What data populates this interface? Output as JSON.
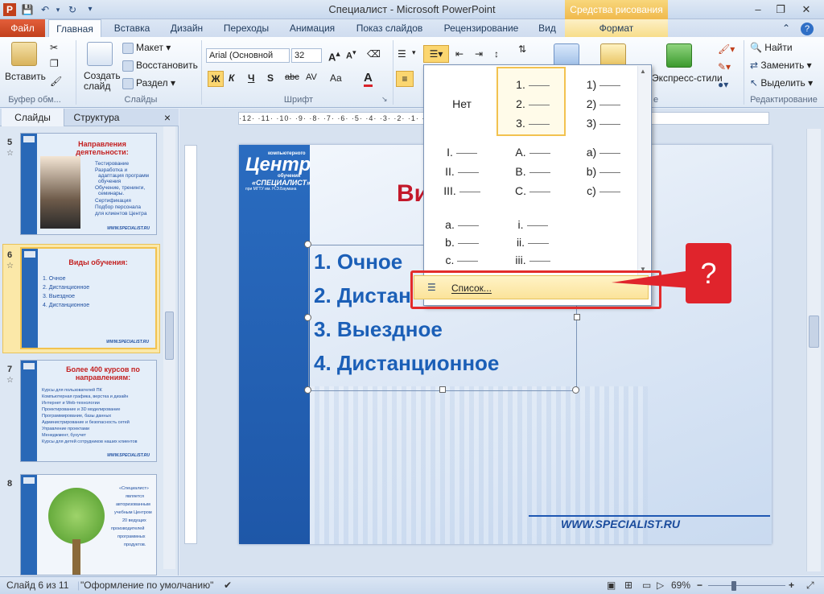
{
  "app": {
    "title": "Специалист - Microsoft PowerPoint",
    "contextual_tab": "Средства рисования"
  },
  "tabs": [
    {
      "label": "Файл"
    },
    {
      "label": "Главная"
    },
    {
      "label": "Вставка"
    },
    {
      "label": "Дизайн"
    },
    {
      "label": "Переходы"
    },
    {
      "label": "Анимация"
    },
    {
      "label": "Показ слайдов"
    },
    {
      "label": "Рецензирование"
    },
    {
      "label": "Вид"
    },
    {
      "label": "Формат"
    }
  ],
  "ribbon": {
    "clipboard": {
      "paste": "Вставить",
      "group": "Буфер обм..."
    },
    "slides": {
      "new_slide": "Создать слайд",
      "layout": "Макет",
      "reset": "Восстановить",
      "section": "Раздел",
      "group": "Слайды"
    },
    "font": {
      "name": "Arial (Основной",
      "size": "32",
      "group": "Шрифт",
      "bold": "Ж",
      "italic": "К",
      "underline": "Ч",
      "shadow": "S",
      "strike": "abc",
      "spacing": "AV",
      "case": "Aa",
      "color": "A"
    },
    "drawing": {
      "quick_styles": "Экспресс-стили",
      "group_suffix": "е"
    },
    "editing": {
      "find": "Найти",
      "replace": "Заменить",
      "select": "Выделить",
      "group": "Редактирование"
    }
  },
  "left_panel": {
    "tabs": [
      "Слайды",
      "Структура"
    ],
    "close": "×",
    "thumbnails": [
      {
        "num": "5",
        "title": "Направления  деятельности:",
        "lines": [
          "Тестирование",
          "Разработка и",
          "адаптация программ",
          "обучения",
          "Обучение, тренинги,",
          "семинары.",
          "Сертификация",
          "Подбор персонала",
          "для клиентов Центра"
        ],
        "footer": "WWW.SPECIALIST.RU"
      },
      {
        "num": "6",
        "title": "Виды обучения:",
        "lines": [
          "1.  Очное",
          "2.  Дистанционное",
          "3.  Выездное",
          "4.  Дистанционное"
        ],
        "footer": "WWW.SPECIALIST.RU"
      },
      {
        "num": "7",
        "title": "Более  400 курсов  по направлениям:",
        "lines": [
          "Курсы для пользователей ПК",
          "Компьютерная графика, верстка и дизайн",
          "Интернет и Web-технологии",
          "Проектирование и 3D моделирование",
          "Программирование, базы данных",
          "Администрирование и безопасность сетей",
          "Управление проектами",
          "Менеджмент, бухучет",
          "Курсы для детей сотрудников наших клиентов"
        ],
        "footer": "WWW.SPECIALIST.RU"
      },
      {
        "num": "8",
        "title": "",
        "lines": [
          "«Специалист»",
          "является",
          "авторизованным",
          "учебным Центром",
          "20 ведущих",
          "производителей",
          "программных",
          "продуктов."
        ],
        "footer": ""
      }
    ]
  },
  "ruler": {
    "horizontal": "·12·  ·11·  ·10·  ·9·  ·8·  ·7·  ·6·  ·5·  ·4·  ·3·  ·2·  ·1·  ·0·  ·1·  ·2·  ·3·  ·4·  ·5·  ·6·  ·7·  ·8·  ·9·  ·10·  ·11·  ·12·"
  },
  "slide": {
    "logo_line1": "компьютерного",
    "logo_main": "Центр",
    "logo_line2": "обучения",
    "logo_quote": "«СПЕЦИАЛИСТ»",
    "logo_sub": "при МГТУ им. Н.Э.Баумана",
    "title_visible": "Ви",
    "items": [
      "1.  Очное",
      "2.  Дистан",
      "3.  Выездное",
      "4.  Дистанционное"
    ],
    "url": "WWW.SPECIALIST.RU"
  },
  "numbering_gallery": {
    "none_label": "Нет",
    "cells": [
      [
        "1.",
        "2.",
        "3."
      ],
      [
        "1)",
        "2)",
        "3)"
      ],
      [
        "I.",
        "II.",
        "III."
      ],
      [
        "A.",
        "B.",
        "C."
      ],
      [
        "a)",
        "b)",
        "c)"
      ],
      [
        "a.",
        "b.",
        "c."
      ],
      [
        "i.",
        "ii.",
        "iii."
      ]
    ],
    "list_option": "Список..."
  },
  "callout": {
    "text": "?"
  },
  "status": {
    "slide_info": "Слайд 6 из 11",
    "theme": "\"Оформление по умолчанию\"",
    "zoom": "69%",
    "minus": "−",
    "plus": "+"
  },
  "colors": {
    "accent_red": "#e0242c",
    "highlight": "#fbe39a",
    "slide_blue": "#1b5fb7",
    "title_red": "#c3182a"
  }
}
